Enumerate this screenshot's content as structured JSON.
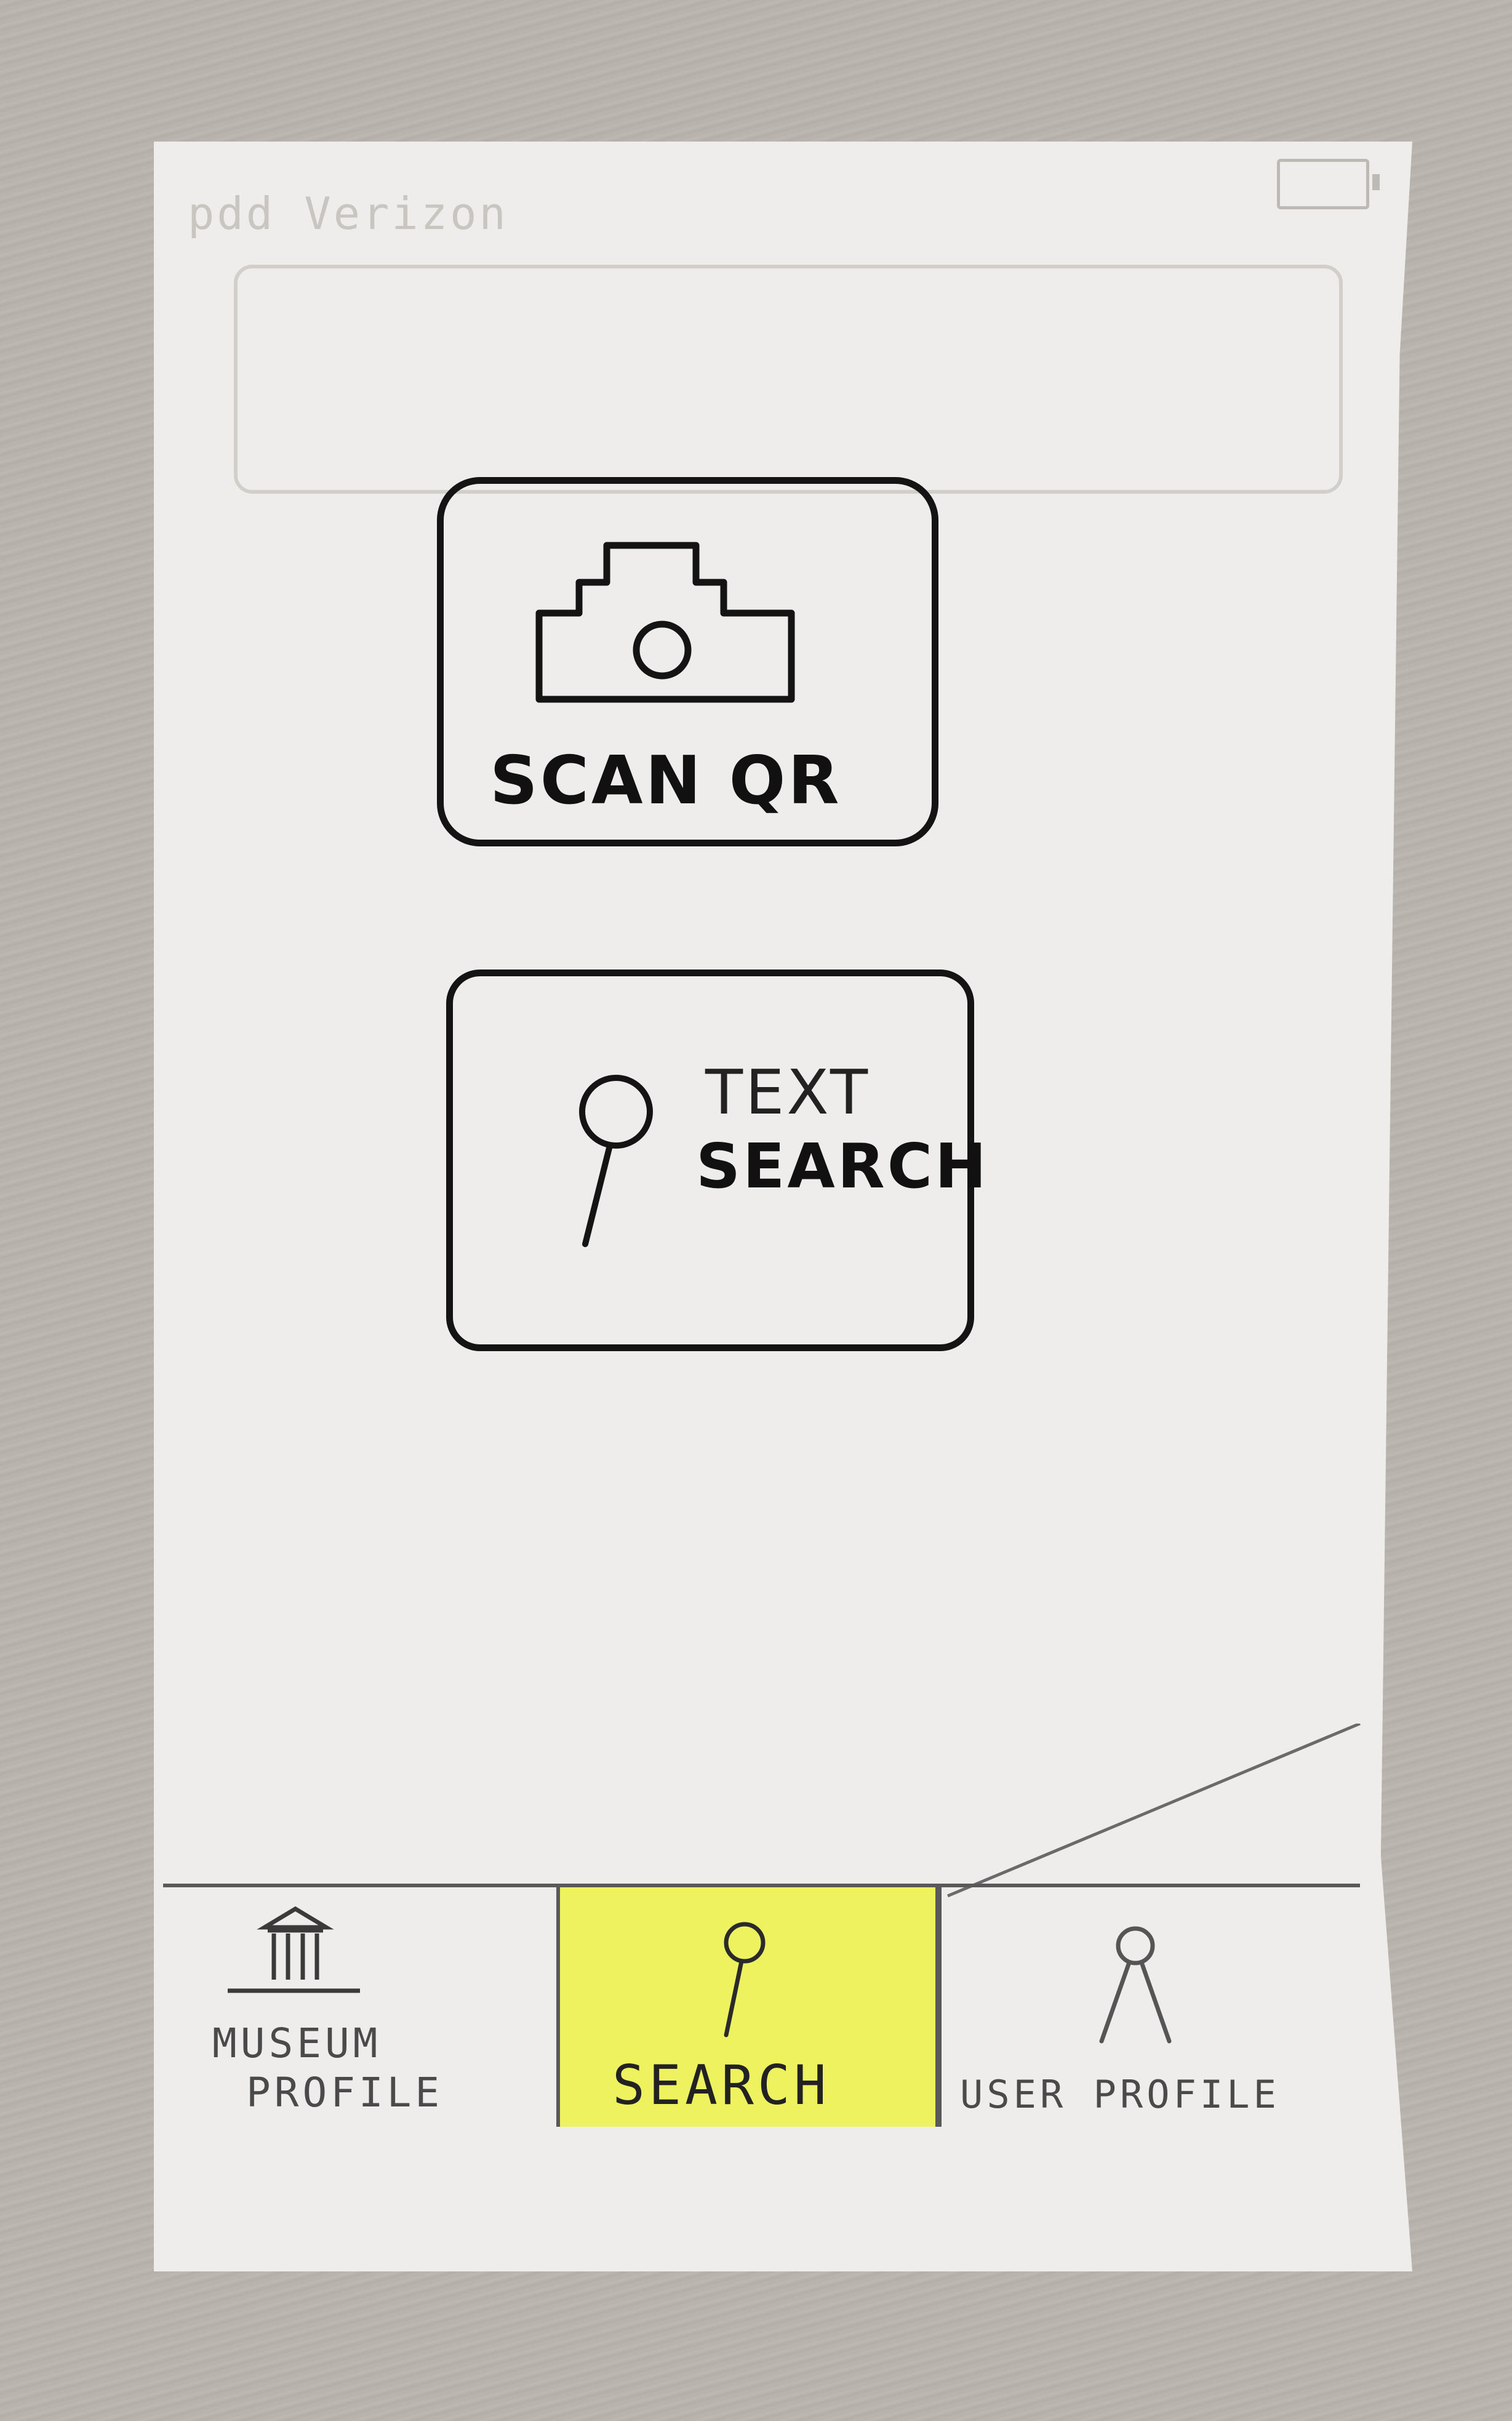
{
  "status_bar": {
    "carrier_text": "pdd Verizon",
    "battery_icon": "battery-icon"
  },
  "main": {
    "scan_qr": {
      "label": "SCAN QR",
      "icon": "camera-icon"
    },
    "text_search": {
      "label_line1": "TEXT",
      "label_line2": "SEARCH",
      "icon": "magnifier-icon"
    }
  },
  "bottom_nav": {
    "tabs": [
      {
        "label_line1": "MUSEUM",
        "label_line2": "PROFILE",
        "icon": "museum-icon",
        "active": false
      },
      {
        "label": "SEARCH",
        "icon": "search-icon",
        "active": true
      },
      {
        "label": "USER PROFILE",
        "icon": "user-icon",
        "active": false
      }
    ]
  },
  "colors": {
    "active_tab_bg": "#eef25f",
    "ink": "#141414",
    "paper": "#efedeb"
  }
}
